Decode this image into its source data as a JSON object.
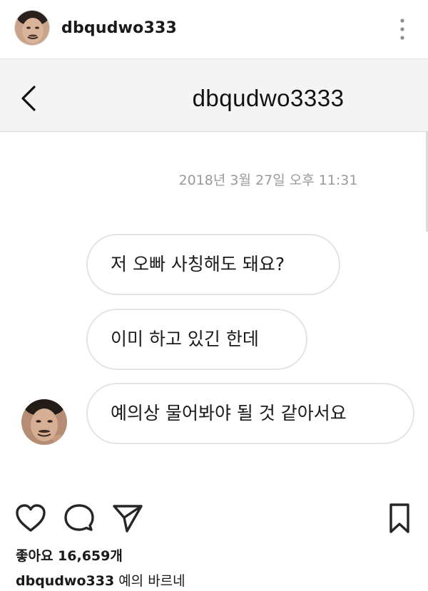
{
  "post": {
    "username": "dbqudwo333",
    "more_icon": "more-vertical-icon"
  },
  "dm": {
    "title": "dbqudwo3333",
    "back_icon": "chevron-left-icon",
    "timestamp": "2018년 3월 27일 오후 11:31",
    "messages": [
      {
        "text": "저 오빠 사칭해도 돼요?"
      },
      {
        "text": "이미 하고 있긴 한데"
      },
      {
        "text": "예의상 물어봐야 될 것 같아서요"
      }
    ]
  },
  "actions": {
    "like_icon": "heart-icon",
    "comment_icon": "comment-icon",
    "share_icon": "send-icon",
    "save_icon": "bookmark-icon"
  },
  "likes": {
    "text": "좋아요 16,659개"
  },
  "caption": {
    "username": "dbqudwo333",
    "text": "예의 바르네"
  },
  "colors": {
    "bubble_border": "#e4e4e4",
    "timestamp": "#9a9a9a",
    "topbar_bg": "#f4f4f4"
  }
}
